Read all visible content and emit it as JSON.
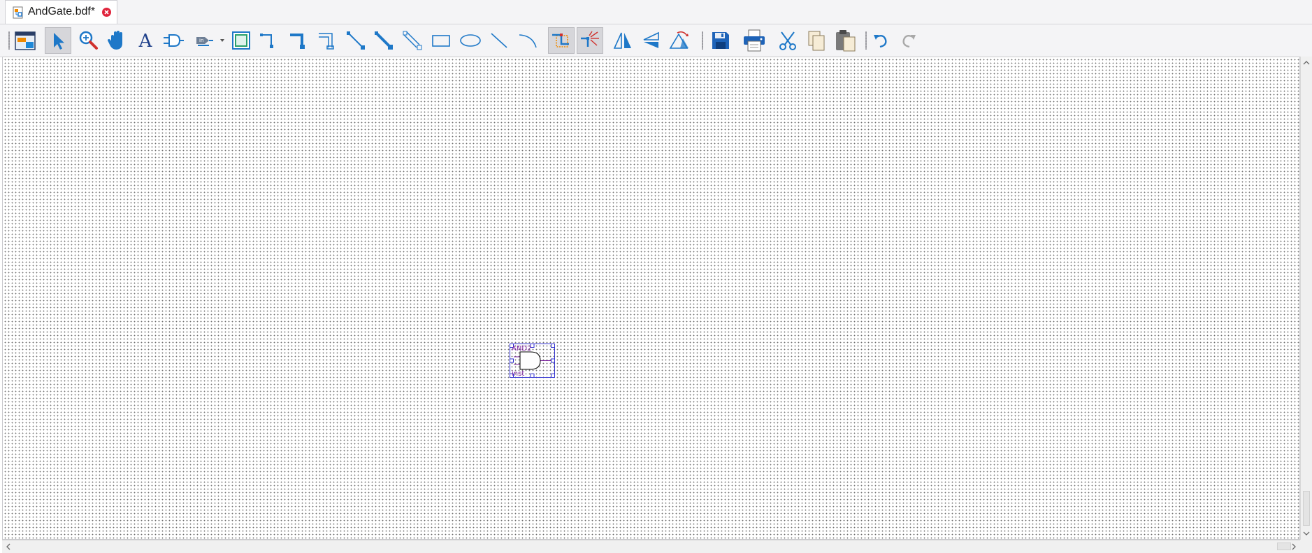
{
  "tab": {
    "label": "AndGate.bdf*",
    "close_color": "#e0243c"
  },
  "toolbar": {
    "items": [
      {
        "name": "block-editor-window-icon"
      },
      {
        "name": "selection-tool-icon",
        "pressed": true
      },
      {
        "name": "zoom-tool-icon"
      },
      {
        "name": "hand-tool-icon"
      },
      {
        "name": "text-tool-icon"
      },
      {
        "name": "symbol-tool-icon"
      },
      {
        "name": "pin-tool-icon"
      },
      {
        "name": "block-tool-icon"
      },
      {
        "name": "orthogonal-node-tool-icon"
      },
      {
        "name": "orthogonal-bus-tool-icon"
      },
      {
        "name": "orthogonal-conduit-tool-icon"
      },
      {
        "name": "diagonal-node-tool-icon"
      },
      {
        "name": "diagonal-bus-tool-icon"
      },
      {
        "name": "diagonal-conduit-tool-icon"
      },
      {
        "name": "rectangle-tool-icon"
      },
      {
        "name": "oval-tool-icon"
      },
      {
        "name": "line-tool-icon"
      },
      {
        "name": "arc-tool-icon"
      },
      {
        "name": "partial-line-selection-icon",
        "pressed": true
      },
      {
        "name": "rubberbanding-icon",
        "pressed": true
      },
      {
        "name": "flip-horizontal-icon"
      },
      {
        "name": "flip-vertical-icon"
      },
      {
        "name": "rotate-icon"
      },
      {
        "name": "save-icon"
      },
      {
        "name": "print-icon"
      },
      {
        "name": "cut-icon"
      },
      {
        "name": "copy-icon"
      },
      {
        "name": "paste-icon"
      },
      {
        "name": "undo-icon"
      },
      {
        "name": "redo-icon"
      }
    ]
  },
  "canvas": {
    "symbol": {
      "type_label": "AND2",
      "instance_label": "inst"
    }
  },
  "colors": {
    "accent": "#0a78c8",
    "symbol_outline": "#3030d0",
    "symbol_text": "#7a1e9e"
  }
}
